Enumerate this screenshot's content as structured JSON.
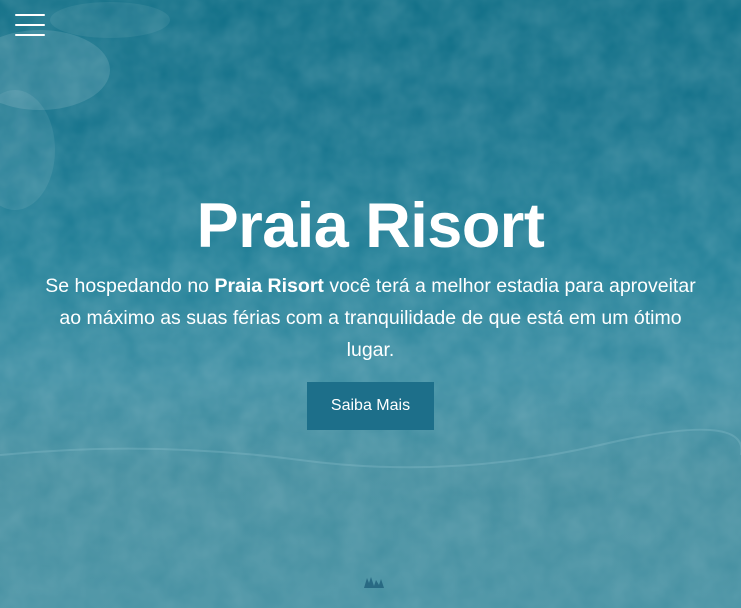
{
  "colors": {
    "sea_dark": "#0c6d85",
    "sea_light": "#3f8a9b",
    "button_bg": "#1d6f8a",
    "text": "#ffffff"
  },
  "nav": {
    "menu_icon": "hamburger-menu-icon"
  },
  "hero": {
    "title": "Praia Risort",
    "description": {
      "before": "Se hospedando no ",
      "highlight": "Praia Risort",
      "after": " você terá a melhor estadia para aproveitar ao máximo as suas férias com a tranquilidade de que está em um ótimo lugar."
    },
    "cta_label": "Saiba Mais"
  }
}
